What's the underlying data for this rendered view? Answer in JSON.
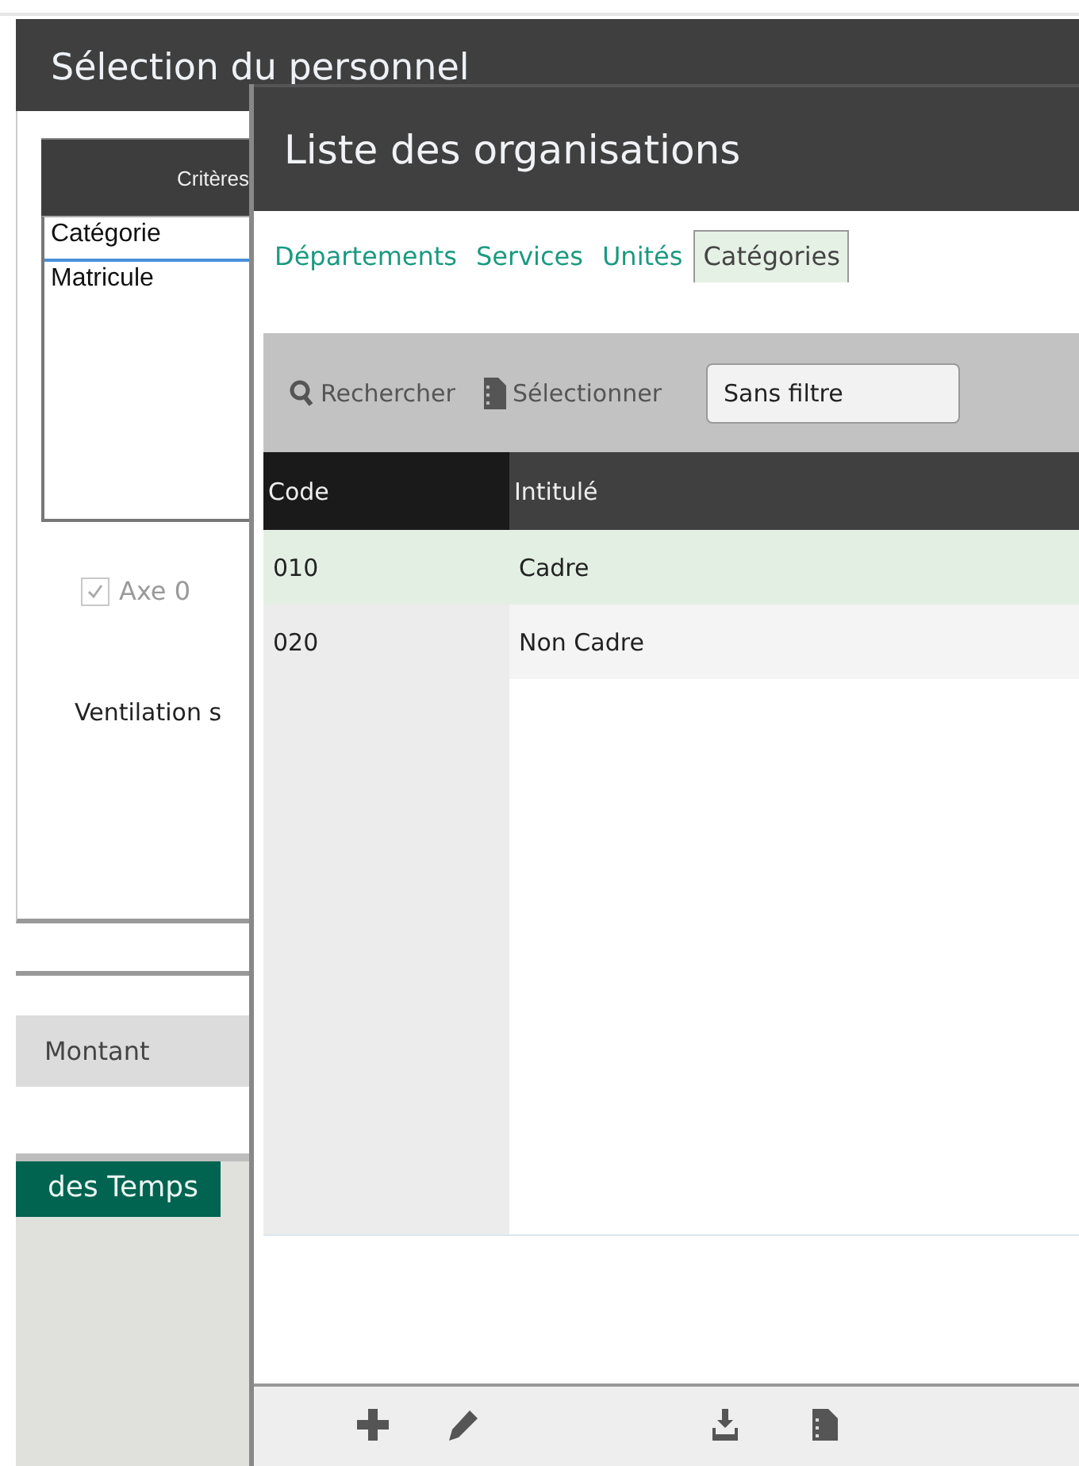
{
  "background_window": {
    "title": "Sélection du personnel",
    "criteria": {
      "header": "Critères",
      "items": [
        {
          "label": "Catégorie",
          "selected": true
        },
        {
          "label": "Matricule",
          "selected": false
        }
      ]
    },
    "axis_checkbox": {
      "label": "Axe 0",
      "checked": true,
      "disabled": true
    },
    "ventilation_label": "Ventilation s",
    "amount_label": "Montant",
    "bottom_tab": "des Temps"
  },
  "dialog": {
    "title": "Liste des organisations",
    "tabs": [
      {
        "label": "Départements",
        "selected": false
      },
      {
        "label": "Services",
        "selected": false
      },
      {
        "label": "Unités",
        "selected": false
      },
      {
        "label": "Catégories",
        "selected": true
      }
    ],
    "toolbar": {
      "search_button": "Rechercher",
      "select_button": "Sélectionner",
      "filter": "Sans filtre"
    },
    "table": {
      "columns": [
        "Code",
        "Intitulé"
      ],
      "rows": [
        {
          "code": "010",
          "label": "Cadre",
          "selected": true
        },
        {
          "code": "020",
          "label": "Non Cadre",
          "selected": false
        }
      ]
    }
  }
}
